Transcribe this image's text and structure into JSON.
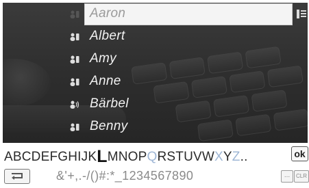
{
  "contacts": [
    {
      "name": "Aaron",
      "icon": "person-phone-icon",
      "selected": true
    },
    {
      "name": "Albert",
      "icon": "person-phone-icon"
    },
    {
      "name": "Amy",
      "icon": "person-phone-icon"
    },
    {
      "name": "Anne",
      "icon": "person-phone-icon"
    },
    {
      "name": "Bärbel",
      "icon": "person-voice-icon"
    },
    {
      "name": "Benny",
      "icon": "person-phone-icon"
    }
  ],
  "alphabet": {
    "before": "ABCDEFGHIJK",
    "current": "L",
    "mid1": "MNOP",
    "dim1": "Q",
    "mid2": "RSTUVW",
    "dim2": "X",
    "mid3": "Y",
    "dim3": "Z",
    "after": "..",
    "ok_label": "ok"
  },
  "bottom": {
    "symbols": "&'+,.-/()#:*_1234567890",
    "dots_label": "...",
    "clr_label": "CLR"
  },
  "colors": {
    "dark_bg": "#2f2f2f",
    "selection": "#f4f4f4",
    "highlight_dim": "#9fb7d6"
  }
}
